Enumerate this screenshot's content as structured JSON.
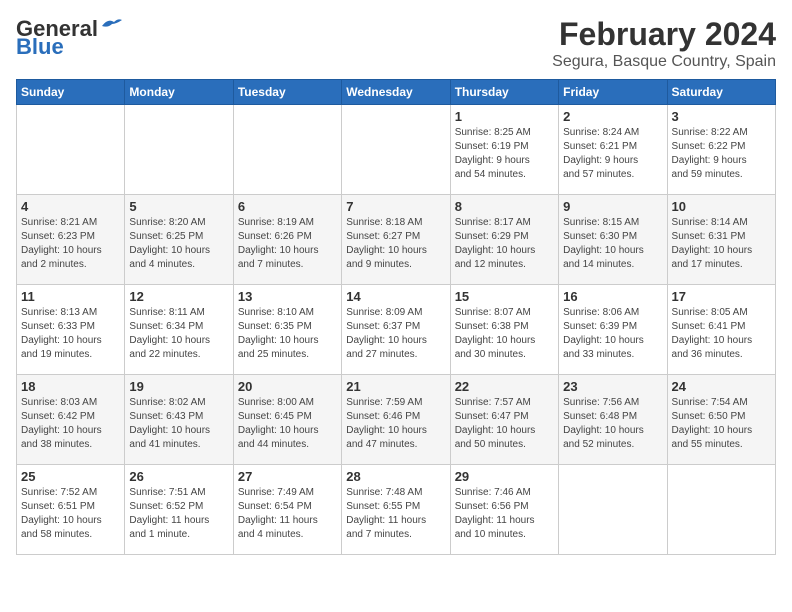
{
  "header": {
    "logo_general": "General",
    "logo_blue": "Blue",
    "title": "February 2024",
    "subtitle": "Segura, Basque Country, Spain"
  },
  "days_of_week": [
    "Sunday",
    "Monday",
    "Tuesday",
    "Wednesday",
    "Thursday",
    "Friday",
    "Saturday"
  ],
  "weeks": [
    [
      {
        "day": "",
        "info": ""
      },
      {
        "day": "",
        "info": ""
      },
      {
        "day": "",
        "info": ""
      },
      {
        "day": "",
        "info": ""
      },
      {
        "day": "1",
        "info": "Sunrise: 8:25 AM\nSunset: 6:19 PM\nDaylight: 9 hours\nand 54 minutes."
      },
      {
        "day": "2",
        "info": "Sunrise: 8:24 AM\nSunset: 6:21 PM\nDaylight: 9 hours\nand 57 minutes."
      },
      {
        "day": "3",
        "info": "Sunrise: 8:22 AM\nSunset: 6:22 PM\nDaylight: 9 hours\nand 59 minutes."
      }
    ],
    [
      {
        "day": "4",
        "info": "Sunrise: 8:21 AM\nSunset: 6:23 PM\nDaylight: 10 hours\nand 2 minutes."
      },
      {
        "day": "5",
        "info": "Sunrise: 8:20 AM\nSunset: 6:25 PM\nDaylight: 10 hours\nand 4 minutes."
      },
      {
        "day": "6",
        "info": "Sunrise: 8:19 AM\nSunset: 6:26 PM\nDaylight: 10 hours\nand 7 minutes."
      },
      {
        "day": "7",
        "info": "Sunrise: 8:18 AM\nSunset: 6:27 PM\nDaylight: 10 hours\nand 9 minutes."
      },
      {
        "day": "8",
        "info": "Sunrise: 8:17 AM\nSunset: 6:29 PM\nDaylight: 10 hours\nand 12 minutes."
      },
      {
        "day": "9",
        "info": "Sunrise: 8:15 AM\nSunset: 6:30 PM\nDaylight: 10 hours\nand 14 minutes."
      },
      {
        "day": "10",
        "info": "Sunrise: 8:14 AM\nSunset: 6:31 PM\nDaylight: 10 hours\nand 17 minutes."
      }
    ],
    [
      {
        "day": "11",
        "info": "Sunrise: 8:13 AM\nSunset: 6:33 PM\nDaylight: 10 hours\nand 19 minutes."
      },
      {
        "day": "12",
        "info": "Sunrise: 8:11 AM\nSunset: 6:34 PM\nDaylight: 10 hours\nand 22 minutes."
      },
      {
        "day": "13",
        "info": "Sunrise: 8:10 AM\nSunset: 6:35 PM\nDaylight: 10 hours\nand 25 minutes."
      },
      {
        "day": "14",
        "info": "Sunrise: 8:09 AM\nSunset: 6:37 PM\nDaylight: 10 hours\nand 27 minutes."
      },
      {
        "day": "15",
        "info": "Sunrise: 8:07 AM\nSunset: 6:38 PM\nDaylight: 10 hours\nand 30 minutes."
      },
      {
        "day": "16",
        "info": "Sunrise: 8:06 AM\nSunset: 6:39 PM\nDaylight: 10 hours\nand 33 minutes."
      },
      {
        "day": "17",
        "info": "Sunrise: 8:05 AM\nSunset: 6:41 PM\nDaylight: 10 hours\nand 36 minutes."
      }
    ],
    [
      {
        "day": "18",
        "info": "Sunrise: 8:03 AM\nSunset: 6:42 PM\nDaylight: 10 hours\nand 38 minutes."
      },
      {
        "day": "19",
        "info": "Sunrise: 8:02 AM\nSunset: 6:43 PM\nDaylight: 10 hours\nand 41 minutes."
      },
      {
        "day": "20",
        "info": "Sunrise: 8:00 AM\nSunset: 6:45 PM\nDaylight: 10 hours\nand 44 minutes."
      },
      {
        "day": "21",
        "info": "Sunrise: 7:59 AM\nSunset: 6:46 PM\nDaylight: 10 hours\nand 47 minutes."
      },
      {
        "day": "22",
        "info": "Sunrise: 7:57 AM\nSunset: 6:47 PM\nDaylight: 10 hours\nand 50 minutes."
      },
      {
        "day": "23",
        "info": "Sunrise: 7:56 AM\nSunset: 6:48 PM\nDaylight: 10 hours\nand 52 minutes."
      },
      {
        "day": "24",
        "info": "Sunrise: 7:54 AM\nSunset: 6:50 PM\nDaylight: 10 hours\nand 55 minutes."
      }
    ],
    [
      {
        "day": "25",
        "info": "Sunrise: 7:52 AM\nSunset: 6:51 PM\nDaylight: 10 hours\nand 58 minutes."
      },
      {
        "day": "26",
        "info": "Sunrise: 7:51 AM\nSunset: 6:52 PM\nDaylight: 11 hours\nand 1 minute."
      },
      {
        "day": "27",
        "info": "Sunrise: 7:49 AM\nSunset: 6:54 PM\nDaylight: 11 hours\nand 4 minutes."
      },
      {
        "day": "28",
        "info": "Sunrise: 7:48 AM\nSunset: 6:55 PM\nDaylight: 11 hours\nand 7 minutes."
      },
      {
        "day": "29",
        "info": "Sunrise: 7:46 AM\nSunset: 6:56 PM\nDaylight: 11 hours\nand 10 minutes."
      },
      {
        "day": "",
        "info": ""
      },
      {
        "day": "",
        "info": ""
      }
    ]
  ]
}
